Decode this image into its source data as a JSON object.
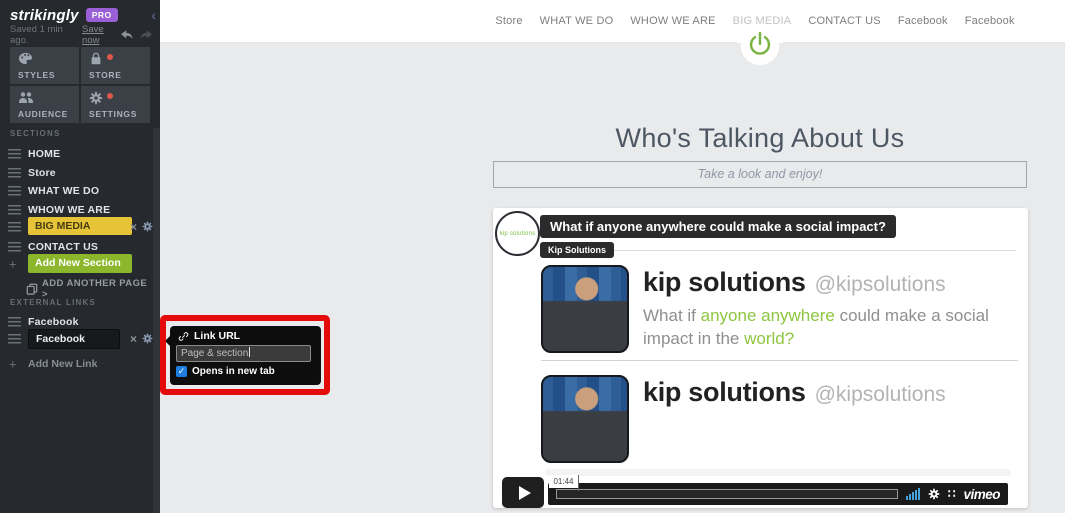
{
  "colors": {
    "pro_purple": "#9a5fd6",
    "accent_yellow": "#e7c337",
    "accent_green": "#8cb72c",
    "annotation_red": "#e60b0b",
    "power_green": "#7cb342",
    "tweet_green": "#8dc63f",
    "checkbox_blue": "#1f7fe0",
    "volume_blue": "#47a3dc",
    "notification_red": "#e0564a"
  },
  "sidebar": {
    "logo": "strikingly",
    "pro_badge": "PRO",
    "saved_text": "Saved 1 min ago.",
    "save_now_label": "Save now",
    "toolbar": [
      {
        "label": "STYLES",
        "icon": "styles-palette-icon",
        "dot": false
      },
      {
        "label": "STORE",
        "icon": "store-bag-icon",
        "dot": true
      },
      {
        "label": "AUDIENCE",
        "icon": "audience-people-icon",
        "dot": false
      },
      {
        "label": "SETTINGS",
        "icon": "settings-gear-icon",
        "dot": true
      }
    ],
    "sections_header": "SECTIONS",
    "sections": [
      {
        "label": "HOME",
        "highlight": false
      },
      {
        "label": "Store",
        "highlight": false
      },
      {
        "label": "WHAT WE DO",
        "highlight": false
      },
      {
        "label": "WHOW WE ARE",
        "highlight": false
      },
      {
        "label": "BIG MEDIA",
        "highlight": true
      },
      {
        "label": "CONTACT US",
        "highlight": false
      }
    ],
    "add_new_section_label": "Add New Section",
    "add_another_page_label": "ADD ANOTHER PAGE >",
    "external_links_header": "EXTERNAL LINKS",
    "external_links": [
      {
        "label": "Facebook",
        "selected": false
      },
      {
        "label": "Facebook",
        "selected": true
      }
    ],
    "add_new_link_label": "Add New Link"
  },
  "link_popup": {
    "title": "Link URL",
    "input_placeholder": "Page & section",
    "checkbox_label": "Opens in new tab",
    "checkbox_checked": true
  },
  "site_nav": {
    "items": [
      {
        "label": "Store",
        "active": false
      },
      {
        "label": "WHAT WE DO",
        "active": false
      },
      {
        "label": "WHOW WE ARE",
        "active": false
      },
      {
        "label": "BIG MEDIA",
        "active": true
      },
      {
        "label": "CONTACT US",
        "active": false
      },
      {
        "label": "Facebook",
        "active": false
      },
      {
        "label": "Facebook",
        "active": false
      }
    ]
  },
  "page_section": {
    "heading": "Who's Talking About Us",
    "subtitle": "Take a look and enjoy!"
  },
  "video": {
    "logo_text": "kip solutions",
    "title_badge": "What if anyone anywhere could make a social impact?",
    "channel_badge": "Kip Solutions",
    "tweets": [
      {
        "name": "kip solutions",
        "handle": "@kipsolutions",
        "body": [
          {
            "text": "What if ",
            "green": false
          },
          {
            "text": "anyone anywhere",
            "green": true
          },
          {
            "text": " could make a social impact in the ",
            "green": false
          },
          {
            "text": "world?",
            "green": true
          }
        ]
      },
      {
        "name": "kip solutions",
        "handle": "@kipsolutions",
        "body": []
      }
    ],
    "player": {
      "time_tooltip": "01:44",
      "brand": "vimeo"
    }
  }
}
